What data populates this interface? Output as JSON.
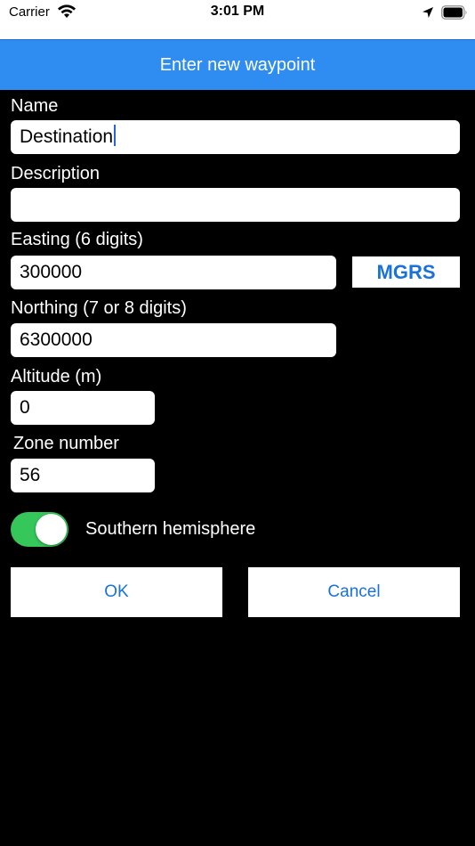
{
  "status_bar": {
    "carrier": "Carrier",
    "time": "3:01 PM",
    "wifi_icon": "wifi-icon",
    "location_icon": "location-arrow-icon",
    "battery_icon": "battery-icon"
  },
  "title": "Enter new waypoint",
  "colors": {
    "title_bar": "#2f8cf1",
    "accent": "#1a72d9",
    "toggle_on": "#35c759",
    "caret": "#2a63d6"
  },
  "form": {
    "name_label": "Name",
    "name_value": "Destination",
    "description_label": "Description",
    "description_value": "",
    "easting_label": "Easting (6 digits)",
    "easting_value": "300000",
    "mgrs_label": "MGRS",
    "northing_label": "Northing (7 or 8 digits)",
    "northing_value": "6300000",
    "altitude_label": "Altitude (m)",
    "altitude_value": "0",
    "zone_label": "Zone number",
    "zone_value": "56",
    "hemisphere_label": "Southern hemisphere",
    "hemisphere_on": true
  },
  "actions": {
    "ok_label": "OK",
    "cancel_label": "Cancel"
  }
}
